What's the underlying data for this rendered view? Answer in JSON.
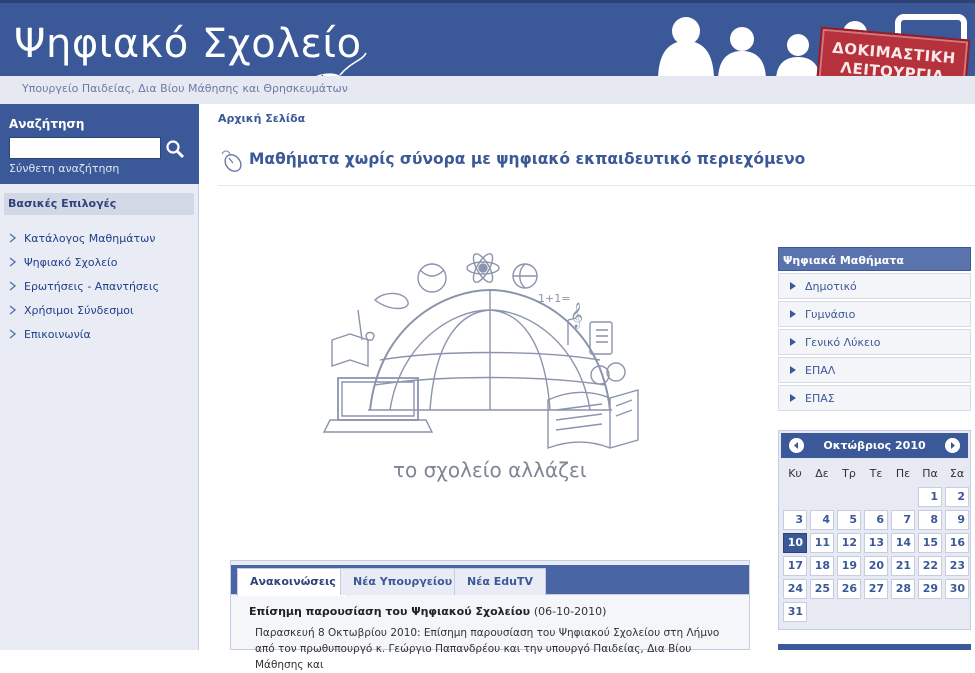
{
  "header": {
    "site_title": "Ψηφιακό Σχολείο",
    "ministry": "Υπουργείο Παιδείας, Δια Βίου Μάθησης και Θρησκευμάτων",
    "stamp_line1": "ΔΟΚΙΜΑΣΤΙΚΗ",
    "stamp_line2": "ΛΕΙΤΟΥΡΓΙΑ"
  },
  "search": {
    "title": "Αναζήτηση",
    "value": "",
    "advanced_link": "Σύνθετη αναζήτηση"
  },
  "menu": {
    "header": "Βασικές Επιλογές",
    "items": [
      {
        "label": "Κατάλογος Μαθημάτων"
      },
      {
        "label": "Ψηφιακό Σχολείο"
      },
      {
        "label": "Ερωτήσεις - Απαντήσεις"
      },
      {
        "label": "Χρήσιμοι Σύνδεσμοι"
      },
      {
        "label": "Επικοινωνία"
      }
    ]
  },
  "main": {
    "breadcrumb": "Αρχική Σελίδα",
    "title": "Μαθήματα χωρίς σύνορα με ψηφιακό εκπαιδευτικό περιεχόμενο",
    "hero_caption": "το σχολείο αλλάζει"
  },
  "tabs": {
    "items": [
      {
        "label": "Ανακοινώσεις",
        "active": true
      },
      {
        "label": "Νέα Υπουργείου",
        "active": false
      },
      {
        "label": "Νέα EduTV",
        "active": false
      }
    ],
    "news": {
      "title": "Επίσημη παρουσίαση του Ψηφιακού Σχολείου",
      "date": "(06-10-2010)",
      "body": "Παρασκευή 8 Οκτωβρίου 2010: Επίσημη παρουσίαση του Ψηφιακού Σχολείου στη Λήμνο από τον πρωθυπουργό κ. Γεώργιο Παπανδρέου και την υπουργό Παιδείας, Δια Βίου Μάθησης και"
    }
  },
  "lessons": {
    "header": "Ψηφιακά Μαθήματα",
    "items": [
      {
        "label": "Δημοτικό"
      },
      {
        "label": "Γυμνάσιο"
      },
      {
        "label": "Γενικό Λύκειο"
      },
      {
        "label": "ΕΠΑΛ"
      },
      {
        "label": "ΕΠΑΣ"
      }
    ]
  },
  "calendar": {
    "month": "Οκτώβριος 2010",
    "weekdays": [
      "Κυ",
      "Δε",
      "Τρ",
      "Τε",
      "Πε",
      "Πα",
      "Σα"
    ],
    "weeks": [
      [
        "",
        "",
        "",
        "",
        "",
        "1",
        "2"
      ],
      [
        "3",
        "4",
        "5",
        "6",
        "7",
        "8",
        "9"
      ],
      [
        "10",
        "11",
        "12",
        "13",
        "14",
        "15",
        "16"
      ],
      [
        "17",
        "18",
        "19",
        "20",
        "21",
        "22",
        "23"
      ],
      [
        "24",
        "25",
        "26",
        "27",
        "28",
        "29",
        "30"
      ],
      [
        "31",
        "",
        "",
        "",
        "",
        "",
        ""
      ]
    ],
    "today": "10"
  },
  "colors": {
    "brand_blue": "#3b5998",
    "stamp_red": "#b5313c",
    "sidebar_bg": "#e9ecf4"
  }
}
